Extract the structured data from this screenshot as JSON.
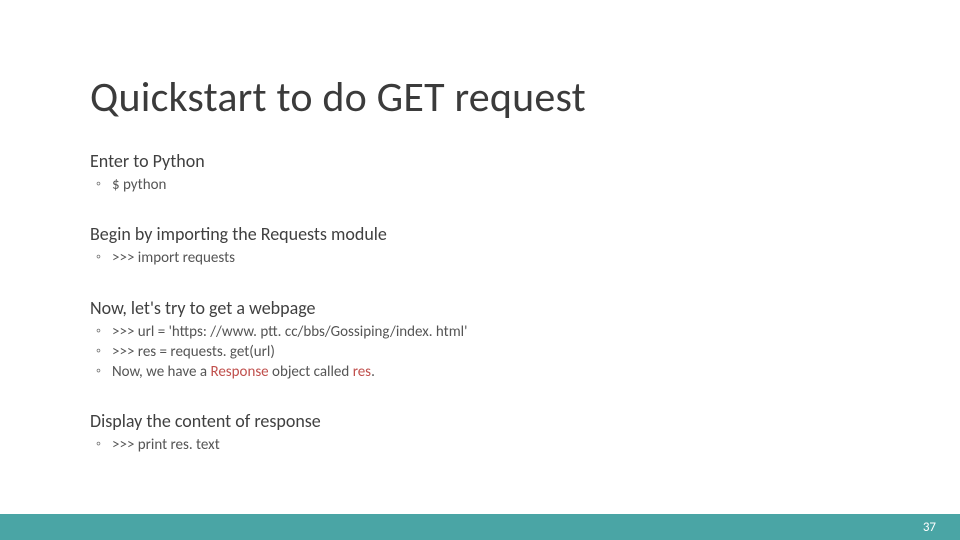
{
  "title": "Quickstart to do GET request",
  "sections": [
    {
      "head": "Enter to Python",
      "items": [
        {
          "pre": "$ python"
        }
      ]
    },
    {
      "head": "Begin by importing the Requests module",
      "items": [
        {
          "pre": ">>> import requests"
        }
      ]
    },
    {
      "head": "Now, let's try to get a webpage",
      "items": [
        {
          "pre": ">>> url = 'https: //www. ptt. cc/bbs/Gossiping/index. html'"
        },
        {
          "pre": ">>> res = requests. get(url)"
        },
        {
          "pre": "Now, we have a ",
          "accent": "Response",
          "mid": " object called ",
          "accent2": "res",
          "post": "."
        }
      ]
    },
    {
      "head": "Display the content of response",
      "items": [
        {
          "pre": ">>> print res. text"
        }
      ]
    }
  ],
  "page_number": "37"
}
